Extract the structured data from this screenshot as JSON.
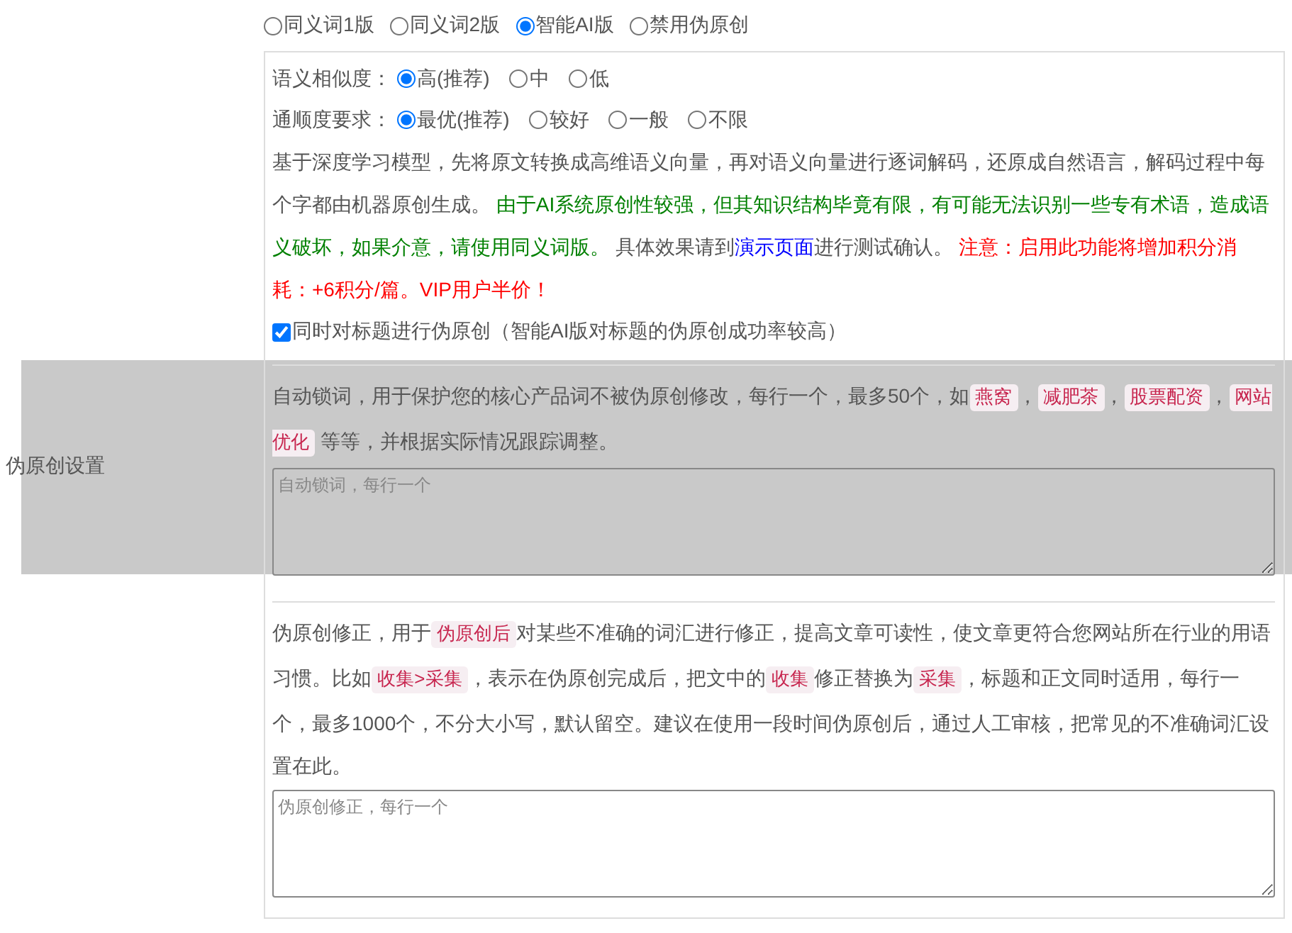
{
  "setting_label": "伪原创设置",
  "modes": [
    {
      "label": "同义词1版",
      "selected": false
    },
    {
      "label": "同义词2版",
      "selected": false
    },
    {
      "label": "智能AI版",
      "selected": true
    },
    {
      "label": "禁用伪原创",
      "selected": false
    }
  ],
  "similarity": {
    "label": "语义相似度：",
    "options": [
      {
        "label": "高(推荐)",
        "selected": true
      },
      {
        "label": "中",
        "selected": false
      },
      {
        "label": "低",
        "selected": false
      }
    ]
  },
  "fluency": {
    "label": "通顺度要求：",
    "options": [
      {
        "label": "最优(推荐)",
        "selected": true
      },
      {
        "label": "较好",
        "selected": false
      },
      {
        "label": "一般",
        "selected": false
      },
      {
        "label": "不限",
        "selected": false
      }
    ]
  },
  "ai_description": [
    {
      "kind": "text",
      "text": "基于深度学习模型，先将原文转换成高维语义向量，再对语义向量进行逐词解码，还原成自然语言，解码过程中每个字都由机器原创生成。"
    },
    {
      "kind": "green",
      "text": " 由于AI系统原创性较强，但其知识结构毕竟有限，有可能无法识别一些专有术语，造成语义破坏，如果介意，请使用同义词版。"
    },
    {
      "kind": "text",
      "text": " 具体效果请到"
    },
    {
      "kind": "link",
      "text": "演示页面"
    },
    {
      "kind": "text",
      "text": "进行测试确认。"
    },
    {
      "kind": "red",
      "text": " 注意：启用此功能将增加积分消耗：+6积分/篇。VIP用户半价！"
    }
  ],
  "title_option": {
    "label": "同时对标题进行伪原创（智能AI版对标题的伪原创成功率较高）",
    "checked": true
  },
  "lock_words": {
    "description": [
      {
        "kind": "text",
        "text": "自动锁词，用于保护您的核心产品词不被伪原创修改，每行一个，最多50个，如"
      },
      {
        "kind": "code",
        "text": "燕窝"
      },
      {
        "kind": "text",
        "text": "，"
      },
      {
        "kind": "code",
        "text": "减肥茶"
      },
      {
        "kind": "text",
        "text": "，"
      },
      {
        "kind": "code",
        "text": "股票配资"
      },
      {
        "kind": "text",
        "text": "，"
      },
      {
        "kind": "code",
        "text": "网站优化"
      },
      {
        "kind": "text",
        "text": " 等等，并根据实际情况跟踪调整。"
      }
    ],
    "placeholder": "自动锁词，每行一个"
  },
  "corrections": {
    "description": [
      {
        "kind": "text",
        "text": "伪原创修正，用于"
      },
      {
        "kind": "code",
        "text": "伪原创后"
      },
      {
        "kind": "text",
        "text": "对某些不准确的词汇进行修正，提高文章可读性，使文章更符合您网站所在行业的用语习惯。比如"
      },
      {
        "kind": "code",
        "text": "收集>采集"
      },
      {
        "kind": "text",
        "text": "，表示在伪原创完成后，把文中的"
      },
      {
        "kind": "code",
        "text": "收集"
      },
      {
        "kind": "text",
        "text": "修正替换为"
      },
      {
        "kind": "code",
        "text": "采集"
      },
      {
        "kind": "text",
        "text": "，标题和正文同时适用，每行一个，最多1000个，不分大小写，默认留空。建议在使用一段时间伪原创后，通过人工审核，把常见的不准确词汇设置在此。"
      }
    ],
    "placeholder": "伪原创修正，每行一个"
  }
}
